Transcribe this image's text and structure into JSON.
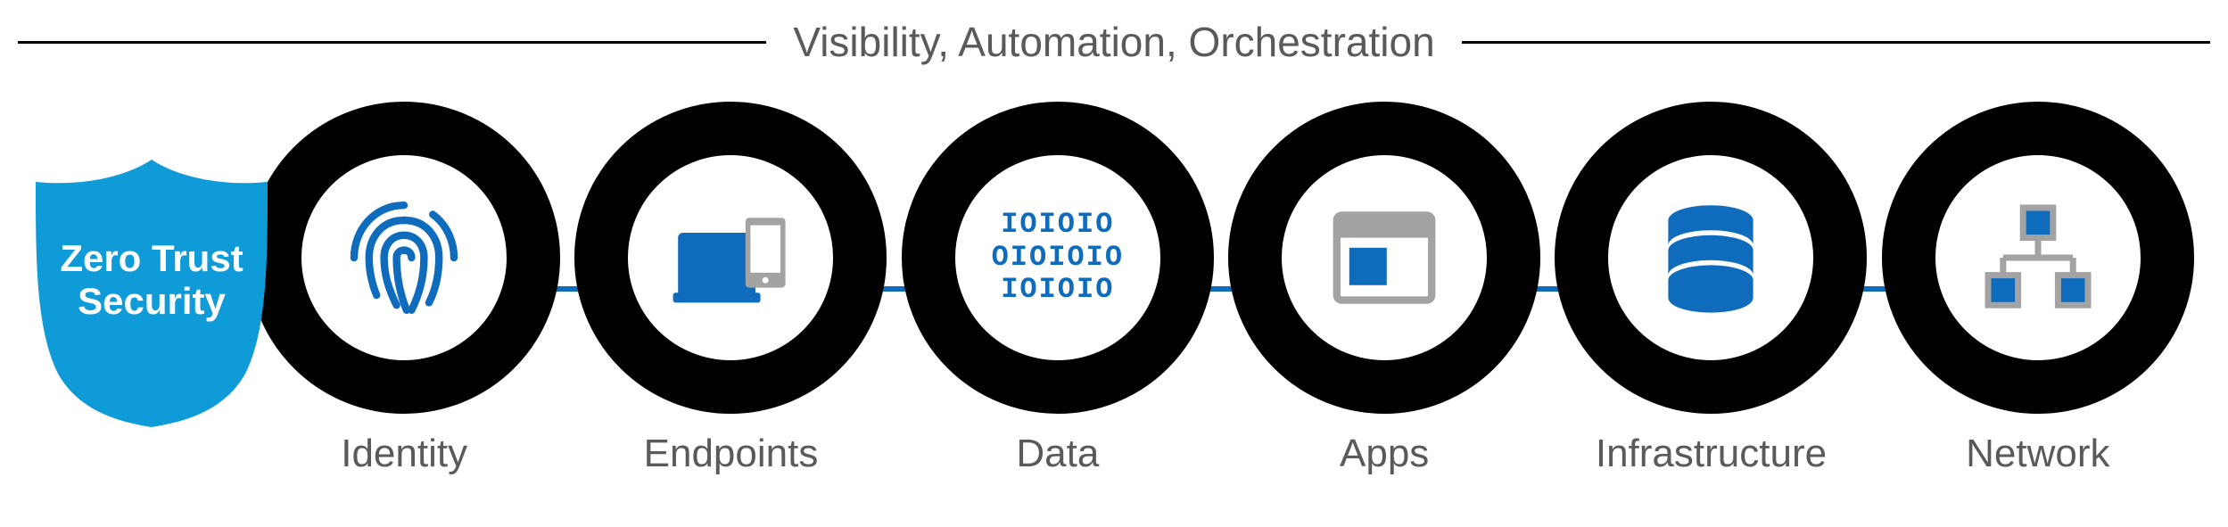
{
  "header": {
    "title": "Visibility, Automation, Orchestration"
  },
  "shield": {
    "label_line1": "Zero Trust",
    "label_line2": "Security"
  },
  "pillars": [
    {
      "id": "identity",
      "label": "Identity",
      "icon": "fingerprint-icon"
    },
    {
      "id": "endpoints",
      "label": "Endpoints",
      "icon": "devices-icon"
    },
    {
      "id": "data",
      "label": "Data",
      "icon": "binary-icon"
    },
    {
      "id": "apps",
      "label": "Apps",
      "icon": "app-window-icon"
    },
    {
      "id": "infrastructure",
      "label": "Infrastructure",
      "icon": "database-icon"
    },
    {
      "id": "network",
      "label": "Network",
      "icon": "network-icon"
    }
  ],
  "binary": {
    "line1": "IOIOIO",
    "line2": "OIOIOIO",
    "line3": "IOIOIO"
  },
  "colors": {
    "accent": "#0f6cbd",
    "ring": "#000000",
    "text": "#5a5a5a",
    "grey": "#a3a3a3"
  }
}
